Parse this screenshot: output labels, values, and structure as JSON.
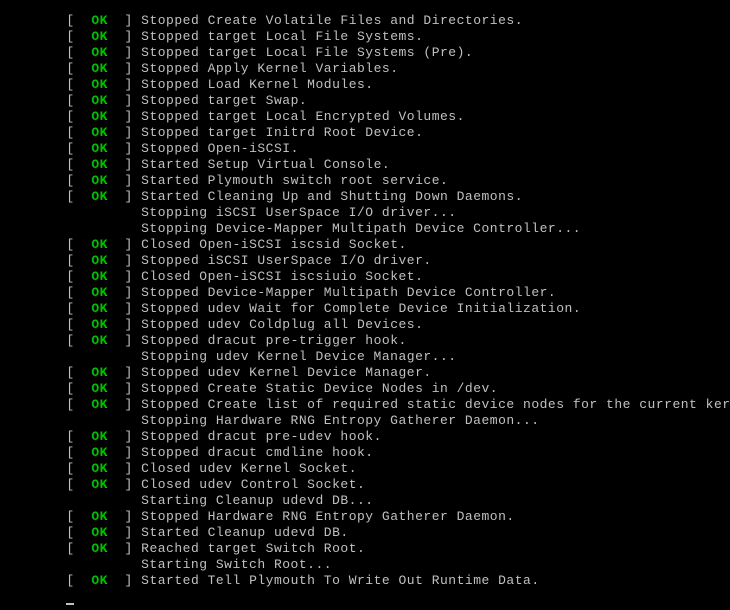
{
  "ok_label": "OK",
  "indent": "        ",
  "msg_indent": "                 ",
  "lines": [
    {
      "type": "ok",
      "text": "Stopped Create Volatile Files and Directories."
    },
    {
      "type": "ok",
      "text": "Stopped target Local File Systems."
    },
    {
      "type": "ok",
      "text": "Stopped target Local File Systems (Pre)."
    },
    {
      "type": "ok",
      "text": "Stopped Apply Kernel Variables."
    },
    {
      "type": "ok",
      "text": "Stopped Load Kernel Modules."
    },
    {
      "type": "ok",
      "text": "Stopped target Swap."
    },
    {
      "type": "ok",
      "text": "Stopped target Local Encrypted Volumes."
    },
    {
      "type": "ok",
      "text": "Stopped target Initrd Root Device."
    },
    {
      "type": "ok",
      "text": "Stopped Open-iSCSI."
    },
    {
      "type": "ok",
      "text": "Started Setup Virtual Console."
    },
    {
      "type": "ok",
      "text": "Started Plymouth switch root service."
    },
    {
      "type": "ok",
      "text": "Started Cleaning Up and Shutting Down Daemons."
    },
    {
      "type": "msg",
      "text": "Stopping iSCSI UserSpace I/O driver..."
    },
    {
      "type": "msg",
      "text": "Stopping Device-Mapper Multipath Device Controller..."
    },
    {
      "type": "ok",
      "text": "Closed Open-iSCSI iscsid Socket."
    },
    {
      "type": "ok",
      "text": "Stopped iSCSI UserSpace I/O driver."
    },
    {
      "type": "ok",
      "text": "Closed Open-iSCSI iscsiuio Socket."
    },
    {
      "type": "ok",
      "text": "Stopped Device-Mapper Multipath Device Controller."
    },
    {
      "type": "ok",
      "text": "Stopped udev Wait for Complete Device Initialization."
    },
    {
      "type": "ok",
      "text": "Stopped udev Coldplug all Devices."
    },
    {
      "type": "ok",
      "text": "Stopped dracut pre-trigger hook."
    },
    {
      "type": "msg",
      "text": "Stopping udev Kernel Device Manager..."
    },
    {
      "type": "ok",
      "text": "Stopped udev Kernel Device Manager."
    },
    {
      "type": "ok",
      "text": "Stopped Create Static Device Nodes in /dev."
    },
    {
      "type": "ok",
      "text": "Stopped Create list of required static device nodes for the current ker"
    },
    {
      "type": "msg",
      "text": "Stopping Hardware RNG Entropy Gatherer Daemon..."
    },
    {
      "type": "ok",
      "text": "Stopped dracut pre-udev hook."
    },
    {
      "type": "ok",
      "text": "Stopped dracut cmdline hook."
    },
    {
      "type": "ok",
      "text": "Closed udev Kernel Socket."
    },
    {
      "type": "ok",
      "text": "Closed udev Control Socket."
    },
    {
      "type": "msg",
      "text": "Starting Cleanup udevd DB..."
    },
    {
      "type": "ok",
      "text": "Stopped Hardware RNG Entropy Gatherer Daemon."
    },
    {
      "type": "ok",
      "text": "Started Cleanup udevd DB."
    },
    {
      "type": "ok",
      "text": "Reached target Switch Root."
    },
    {
      "type": "msg",
      "text": "Starting Switch Root..."
    },
    {
      "type": "ok",
      "text": "Started Tell Plymouth To Write Out Runtime Data."
    }
  ]
}
